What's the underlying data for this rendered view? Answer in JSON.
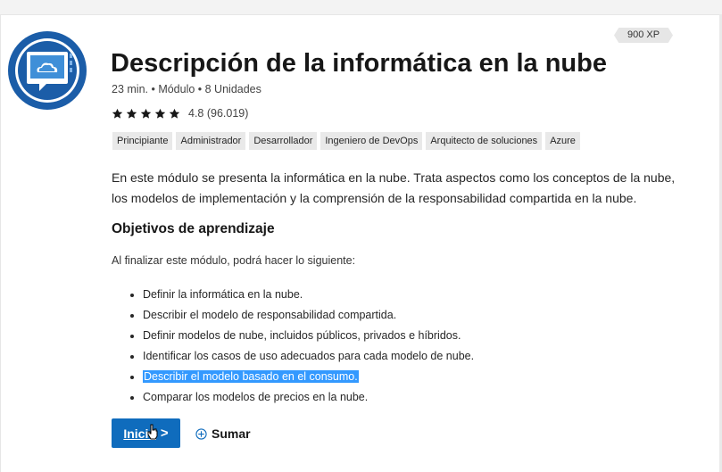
{
  "module": {
    "xp_badge": "900 XP",
    "title": "Descripción de la informática en la nube",
    "meta": "23 min. • Módulo • 8 Unidades",
    "rating": "4.8 (96.019)",
    "rating_stars": 5,
    "tags": [
      "Principiante",
      "Administrador",
      "Desarrollador",
      "Ingeniero de DevOps",
      "Arquitecto de soluciones",
      "Azure"
    ],
    "description_lines": [
      "En este módulo se presenta la informática en la nube. Trata aspectos como los conceptos de la nube,",
      "los modelos de implementación y la comprensión de la responsabilidad compartida en la nube."
    ]
  },
  "objectives": {
    "heading": "Objetivos de aprendizaje",
    "intro": "Al finalizar este módulo, podrá hacer lo siguiente:",
    "items": [
      "Definir la informática en la nube.",
      "Describir el modelo de responsabilidad compartida.",
      "Definir modelos de nube, incluidos públicos, privados e híbridos.",
      "Identificar los casos de uso adecuados para cada modelo de nube.",
      "Describir el modelo basado en el consumo.",
      "Comparar los modelos de precios en la nube."
    ],
    "highlighted_item_index": 4
  },
  "actions": {
    "start_label": "Inicio",
    "start_chevron": ">",
    "add_label": "Sumar"
  },
  "icons": {
    "module": "cloud-monitor-icon",
    "star": "star-icon",
    "add": "circle-plus-icon",
    "cursor": "pointer-cursor-icon"
  },
  "colors": {
    "primary_button": "#0f6cbd",
    "selection_highlight": "#3399ff",
    "icon_outer_ring": "#1b5da8",
    "icon_screen": "#3f8fd8",
    "tag_background": "#e9e9e9"
  }
}
